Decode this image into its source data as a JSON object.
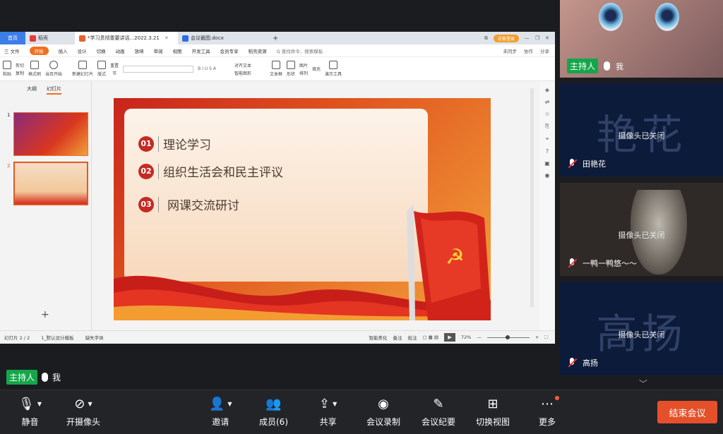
{
  "wps": {
    "tabs": [
      {
        "label": "首页"
      },
      {
        "label": "稻壳"
      },
      {
        "label": "*学习贯彻重要讲话...2022.3.21"
      },
      {
        "label": "会议截图.docx"
      }
    ],
    "login": "访客登录",
    "menu": [
      "三 文件",
      "开始",
      "插入",
      "设计",
      "切换",
      "动画",
      "放映",
      "审阅",
      "视图",
      "开发工具",
      "会员专享",
      "稻壳资源"
    ],
    "menu_active": "开始",
    "search": "Q 查找命令、搜索模板",
    "menu_right": [
      "未同步",
      "协作",
      "分享"
    ],
    "ribbon": [
      "粘贴",
      "剪切",
      "复制",
      "格式刷",
      "当页开始",
      "新建幻灯片",
      "版式",
      "节",
      "重置",
      "对齐文本",
      "智能图形",
      "文本框",
      "形状",
      "排列",
      "图片",
      "填充",
      "演示工具"
    ],
    "panel_tabs": [
      "大纲",
      "幻灯片"
    ],
    "slide_nums": [
      "1",
      "2"
    ],
    "slide": {
      "items": [
        {
          "num": "01",
          "text": "理论学习"
        },
        {
          "num": "02",
          "text": "组织生活会和民主评议"
        },
        {
          "num": "03",
          "text": "网课交流研讨"
        }
      ]
    },
    "status": {
      "page": "幻灯片 2 / 2",
      "theme": "1_默认设计模板",
      "font": "缺失字体",
      "beautify": "智能美化",
      "notes": "备注",
      "comment": "批注",
      "zoom": "72%"
    }
  },
  "host_tag": {
    "role": "主持人",
    "name": "我"
  },
  "participants": [
    {
      "role": "主持人",
      "name": "我",
      "avatar": "",
      "cam": ""
    },
    {
      "name": "田艳花",
      "avatar": "艳花",
      "cam": "摄像头已关闭"
    },
    {
      "name": "一鸭一鸭悠～～",
      "avatar": "",
      "cam": "摄像头已关闭"
    },
    {
      "name": "高扬",
      "avatar": "高扬",
      "cam": "摄像头已关闭"
    }
  ],
  "controls": {
    "mute": "静音",
    "camera": "开摄像头",
    "invite": "邀请",
    "members": "成员(6)",
    "share": "共享",
    "record": "会议录制",
    "minutes": "会议纪要",
    "view": "切换视图",
    "more": "更多",
    "end": "结束会议"
  }
}
